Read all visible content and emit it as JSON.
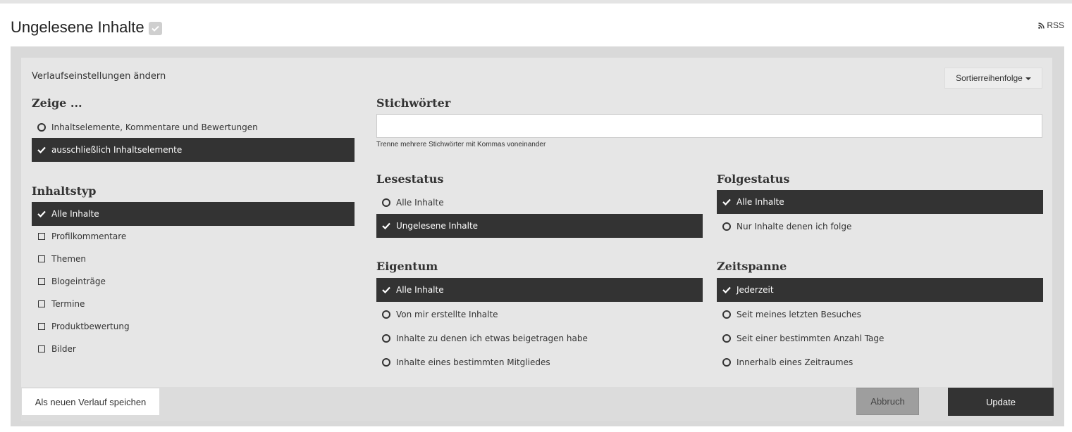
{
  "header": {
    "title": "Ungelesene Inhalte",
    "rss_label": "RSS"
  },
  "panel": {
    "subtitle": "Verlaufseinstellungen ändern",
    "sort_label": "Sortierreihenfolge",
    "show": {
      "heading": "Zeige ...",
      "options": [
        {
          "label": "Inhaltselemente, Kommentare und Bewertungen",
          "selected": false
        },
        {
          "label": "ausschließlich Inhaltselemente",
          "selected": true
        }
      ]
    },
    "content_type": {
      "heading": "Inhaltstyp",
      "options": [
        {
          "label": "Alle Inhalte",
          "selected": true
        },
        {
          "label": "Profilkommentare",
          "selected": false
        },
        {
          "label": "Themen",
          "selected": false
        },
        {
          "label": "Blogeinträge",
          "selected": false
        },
        {
          "label": "Termine",
          "selected": false
        },
        {
          "label": "Produktbewertung",
          "selected": false
        },
        {
          "label": "Bilder",
          "selected": false
        }
      ]
    },
    "keywords": {
      "heading": "Stichwörter",
      "value": "",
      "hint": "Trenne mehrere Stichwörter mit Kommas voneinander"
    },
    "read_status": {
      "heading": "Lesestatus",
      "options": [
        {
          "label": "Alle Inhalte",
          "selected": false
        },
        {
          "label": "Ungelesene Inhalte",
          "selected": true
        }
      ]
    },
    "follow_status": {
      "heading": "Folgestatus",
      "options": [
        {
          "label": "Alle Inhalte",
          "selected": true
        },
        {
          "label": "Nur Inhalte denen ich folge",
          "selected": false
        }
      ]
    },
    "ownership": {
      "heading": "Eigentum",
      "options": [
        {
          "label": "Alle Inhalte",
          "selected": true
        },
        {
          "label": "Von mir erstellte Inhalte",
          "selected": false
        },
        {
          "label": "Inhalte zu denen ich etwas beigetragen habe",
          "selected": false
        },
        {
          "label": "Inhalte eines bestimmten Mitgliedes",
          "selected": false
        }
      ]
    },
    "timespan": {
      "heading": "Zeitspanne",
      "options": [
        {
          "label": "Jederzeit",
          "selected": true
        },
        {
          "label": "Seit meines letzten Besuches",
          "selected": false
        },
        {
          "label": "Seit einer bestimmten Anzahl Tage",
          "selected": false
        },
        {
          "label": "Innerhalb eines Zeitraumes",
          "selected": false
        }
      ]
    }
  },
  "footer": {
    "save_label": "Als neuen Verlauf speichen",
    "cancel_label": "Abbruch",
    "update_label": "Update"
  },
  "colors": {
    "selected_bg": "#333333",
    "panel_bg": "#e6e6e6",
    "outer_bg": "#d9d9d9"
  }
}
